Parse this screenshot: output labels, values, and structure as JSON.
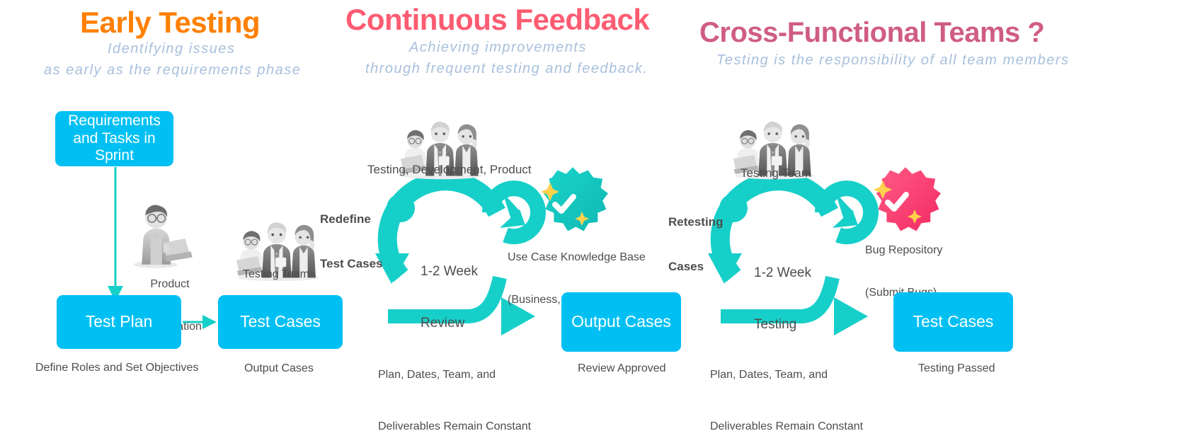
{
  "sections": [
    {
      "title": "Early Testing",
      "title_color": "#ff8000",
      "subtitle_line1": "Identifying  issues",
      "subtitle_line2": "as  early  as  the  requirements  phase",
      "suffix": ""
    },
    {
      "title": "Continuous Feedback",
      "title_color": "#fc5c72",
      "subtitle_line1": "Achieving  improvements",
      "subtitle_line2": "through  frequent  testing  and  feedback.",
      "suffix": ""
    },
    {
      "title": "Cross-Functional Teams",
      "title_color": "#cf5d83",
      "subtitle_line1": "Testing  is  the  responsibility  of  all  team  members",
      "subtitle_line2": "",
      "suffix": "?"
    }
  ],
  "colors": {
    "box_blue": "#00c0f3",
    "arrow_teal": "#17cfc9",
    "badge_teal": "#14c8c0",
    "badge_pink": "#fb3e6e",
    "sparkle_yellow": "#ffd24d",
    "subtitle_blue": "#a8c0dd",
    "caption_gray": "#4d4d4d"
  },
  "column1": {
    "box_top": "Requirements\nand Tasks in\nSprint",
    "figure_label_line1": "Product",
    "figure_label_line2": "Presentation",
    "team_label": "Testing Team",
    "box_left": "Test Plan",
    "box_right": "Test Cases",
    "caption_left": "Define Roles and Set Objectives",
    "caption_right": "Output Cases"
  },
  "column2": {
    "team_label": "Testing, Development, Product",
    "loop_label_in_line1": "Redefine",
    "loop_label_in_line2": "Test Cases",
    "cycle_line1": "1-2 Week",
    "cycle_line2": "Review",
    "badge_label_line1": "Use Case Knowledge Base",
    "badge_label_line2": "(Business, Technical, Experience)",
    "box_right": "Output Cases",
    "caption_left_line1": "Plan, Dates, Team, and",
    "caption_left_line2": "Deliverables Remain Constant",
    "caption_right": "Review Approved"
  },
  "column3": {
    "team_label": "Testing Team",
    "loop_label_in_line1": "Retesting",
    "loop_label_in_line2": "Cases",
    "cycle_line1": "1-2 Week",
    "cycle_line2": "Testing",
    "badge_label_line1": "Bug Repository",
    "badge_label_line2": "(Submit Bugs)",
    "box_right": "Test Cases",
    "caption_left_line1": "Plan, Dates, Team, and",
    "caption_left_line2": "Deliverables Remain Constant",
    "caption_right": "Testing Passed"
  },
  "icons": {
    "person_laptop": "person-with-laptop-icon",
    "team_group": "team-group-icon",
    "check_badge": "check-badge-icon",
    "bug_badge": "bug-badge-icon",
    "sparkle": "sparkle-icon",
    "arrow_down": "arrow-down-icon",
    "arrow_right": "arrow-right-icon",
    "cycle_loop": "cycle-loop-arrow-icon"
  }
}
